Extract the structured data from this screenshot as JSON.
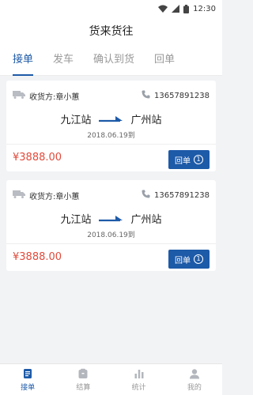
{
  "status_bar": {
    "time": "12:30"
  },
  "header": {
    "title": "货来货往"
  },
  "tabs": [
    {
      "label": "接单",
      "active": true
    },
    {
      "label": "发车",
      "active": false
    },
    {
      "label": "确认到货",
      "active": false
    },
    {
      "label": "回单",
      "active": false
    }
  ],
  "orders": [
    {
      "consignee": "收货方:章小蕙",
      "phone": "13657891238",
      "from": "九江站",
      "to": "广州站",
      "date": "2018.06.19到",
      "price": "¥3888.00",
      "button": "回单",
      "count": "1"
    },
    {
      "consignee": "收货方:章小蕙",
      "phone": "13657891238",
      "from": "九江站",
      "to": "广州站",
      "date": "2018.06.19到",
      "price": "¥3888.00",
      "button": "回单",
      "count": "1"
    }
  ],
  "bottom_nav": [
    {
      "label": "接单",
      "icon": "document-icon",
      "active": true
    },
    {
      "label": "结算",
      "icon": "wallet-icon",
      "active": false
    },
    {
      "label": "统计",
      "icon": "bar-chart-icon",
      "active": false
    },
    {
      "label": "我的",
      "icon": "user-icon",
      "active": false
    }
  ],
  "colors": {
    "accent": "#1d5aa8",
    "price": "#e24a3b",
    "background": "#f2f3f5"
  }
}
